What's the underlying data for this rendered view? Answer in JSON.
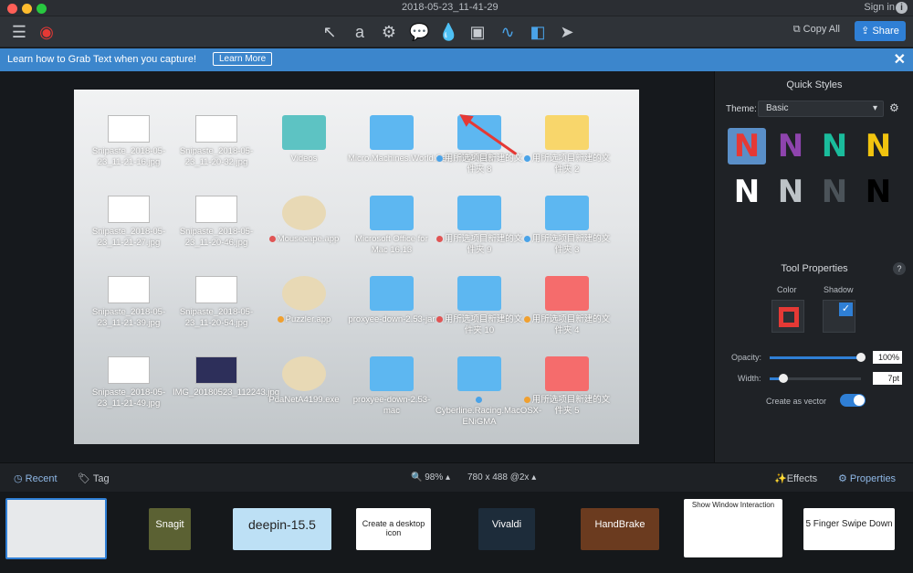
{
  "window": {
    "title": "2018-05-23_11-41-29",
    "sign_in": "Sign in"
  },
  "toolbar": {
    "tools": [
      "arrow-tool",
      "text-tool",
      "stamp-tool",
      "callout-tool",
      "fill-tool",
      "magnify-tool",
      "pen-tool",
      "screenshot-tool",
      "cursor-tool"
    ],
    "copy_all": "Copy All",
    "share": "Share"
  },
  "banner": {
    "text": "Learn how to Grab Text when you capture!",
    "button": "Learn More"
  },
  "capture": {
    "rows": [
      [
        {
          "label": "Snipaste_2018-05-23_11-21-16.jpg",
          "kind": "thumb"
        },
        {
          "label": "Snipaste_2018-05-23_11-20-32.jpg",
          "kind": "thumb"
        },
        {
          "label": "Videos",
          "kind": "teal"
        },
        {
          "label": "Micro.Machines.World.Seri...TIVATED",
          "kind": "blue"
        },
        {
          "label": "用所选项目新建的文件夹 8",
          "kind": "blue",
          "dot": "#4aa3e8"
        },
        {
          "label": "用所选项目新建的文件夹 2",
          "kind": "yellow",
          "dot": "#4aa3e8"
        }
      ],
      [
        {
          "label": "Snipaste_2018-05-23_11-21-27.jpg",
          "kind": "thumb"
        },
        {
          "label": "Snipaste_2018-05-23_11-20-46.jpg",
          "kind": "thumb"
        },
        {
          "label": "Mousecape.app",
          "kind": "app",
          "dot": "#e05555"
        },
        {
          "label": "Microsoft Office for Mac 16.13",
          "kind": "blue"
        },
        {
          "label": "用所选项目新建的文件夹 9",
          "kind": "blue",
          "dot": "#e05555"
        },
        {
          "label": "用所选项目新建的文件夹 3",
          "kind": "blue",
          "dot": "#4aa3e8"
        }
      ],
      [
        {
          "label": "Snipaste_2018-05-23_11-21-39.jpg",
          "kind": "thumb"
        },
        {
          "label": "Snipaste_2018-05-23_11-20-54.jpg",
          "kind": "thumb"
        },
        {
          "label": "Puzzler.app",
          "kind": "app",
          "dot": "#f0a030"
        },
        {
          "label": "proxyee-down-2.53-jar",
          "kind": "blue"
        },
        {
          "label": "用所选项目新建的文件夹 10",
          "kind": "blue",
          "dot": "#e05555"
        },
        {
          "label": "用所选项目新建的文件夹 4",
          "kind": "red",
          "dot": "#f0a030"
        }
      ],
      [
        {
          "label": "Snipaste_2018-05-23_11-21-49.jpg",
          "kind": "thumb"
        },
        {
          "label": "IMG_20180523_112243.jpg",
          "kind": "photo"
        },
        {
          "label": "PdaNetA4199.exe",
          "kind": "app"
        },
        {
          "label": "proxyee-down-2.53-mac",
          "kind": "blue"
        },
        {
          "label": "Cyberline.Racing.MacOSX-ENiGMA",
          "kind": "blue",
          "dot": "#4aa3e8"
        },
        {
          "label": "用所选项目新建的文件夹 5",
          "kind": "red",
          "dot": "#f0a030"
        }
      ]
    ]
  },
  "sidebar": {
    "quick_styles": "Quick Styles",
    "theme_label": "Theme:",
    "theme_value": "Basic",
    "swatches": [
      "#e53935",
      "#8e44ad",
      "#1abc9c",
      "#f1c40f",
      "#ffffff",
      "#bdc3c7",
      "#4b5359",
      "#000000"
    ],
    "tool_properties": "Tool Properties",
    "color_label": "Color",
    "shadow_label": "Shadow",
    "opacity_label": "Opacity:",
    "opacity_value": "100%",
    "width_label": "Width:",
    "width_value": "7pt",
    "vector_label": "Create as vector"
  },
  "bottombar": {
    "recent": "Recent",
    "tag": "Tag",
    "zoom": "98%",
    "size": "780 x 488 @2x",
    "effects": "Effects",
    "properties": "Properties"
  },
  "tray": [
    "Snagit",
    "deepin-15.5",
    "Create a desktop icon",
    "Vivaldi",
    "HandBrake",
    "Show Window Interaction",
    "5 Finger Swipe Down"
  ]
}
